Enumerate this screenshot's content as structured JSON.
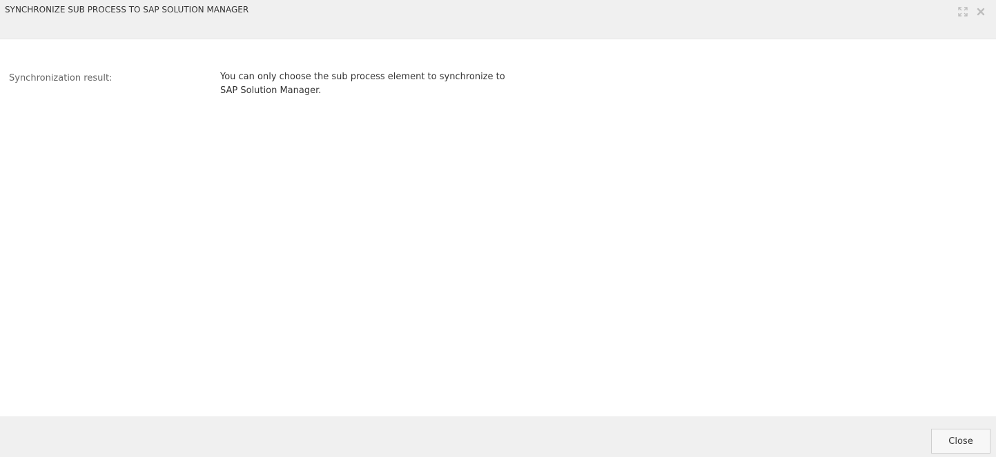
{
  "dialog": {
    "title": "SYNCHRONIZE SUB PROCESS TO SAP SOLUTION MANAGER",
    "icons": {
      "maximize": "expand-icon",
      "close": "close-icon"
    }
  },
  "content": {
    "result_label": "Synchronization result:",
    "result_value": "You can only choose the sub process element to synchronize to SAP Solution Manager."
  },
  "footer": {
    "close_label": "Close"
  },
  "colors": {
    "header_bg": "#f0f0f0",
    "footer_bg": "#f0f0f0",
    "icon_gray": "#bdbdbd"
  }
}
